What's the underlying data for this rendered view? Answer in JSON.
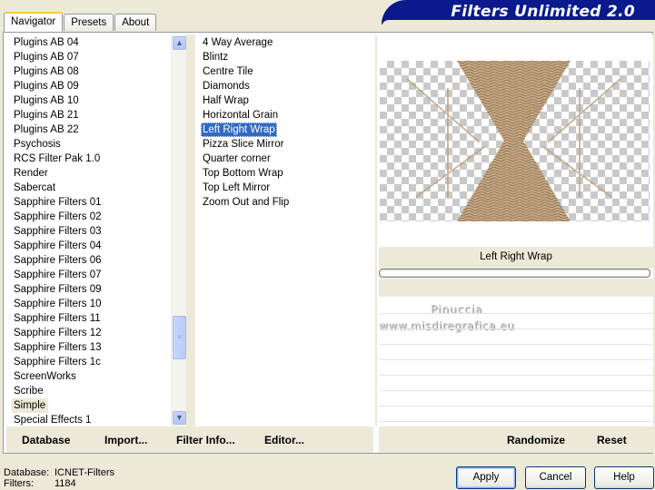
{
  "app": {
    "title": "Filters Unlimited 2.0"
  },
  "tabs": [
    {
      "label": "Navigator",
      "active": true
    },
    {
      "label": "Presets",
      "active": false
    },
    {
      "label": "About",
      "active": false
    }
  ],
  "categories": {
    "items": [
      "Plugins AB 04",
      "Plugins AB 07",
      "Plugins AB 08",
      "Plugins AB 09",
      "Plugins AB 10",
      "Plugins AB 21",
      "Plugins AB 22",
      "Psychosis",
      "RCS Filter Pak 1.0",
      "Render",
      "Sabercat",
      "Sapphire Filters 01",
      "Sapphire Filters 02",
      "Sapphire Filters 03",
      "Sapphire Filters 04",
      "Sapphire Filters 06",
      "Sapphire Filters 07",
      "Sapphire Filters 09",
      "Sapphire Filters 10",
      "Sapphire Filters 11",
      "Sapphire Filters 12",
      "Sapphire Filters 13",
      "Sapphire Filters 1c",
      "ScreenWorks",
      "Scribe",
      "Simple",
      "Special Effects 1"
    ],
    "selected": "Simple"
  },
  "filters": {
    "items": [
      "4 Way Average",
      "Blintz",
      "Centre Tile",
      "Diamonds",
      "Half Wrap",
      "Horizontal Grain",
      "Left Right Wrap",
      "Pizza Slice Mirror",
      "Quarter corner",
      "Top Bottom Wrap",
      "Top Left Mirror",
      "Zoom Out and Flip"
    ],
    "selected": "Left Right Wrap"
  },
  "preview": {
    "filter_name": "Left Right Wrap",
    "progress": 0,
    "watermark_line1": "Pinuccia",
    "watermark_line2": "www.misdiregrafica.eu",
    "colors": {
      "pattern": "#b99c79",
      "pattern_dark": "#8f7252",
      "checker": "#c9c9c9"
    }
  },
  "toolbar": {
    "database": "Database",
    "import": "Import...",
    "filter_info": "Filter Info...",
    "editor": "Editor...",
    "randomize": "Randomize",
    "reset": "Reset"
  },
  "status": {
    "database_label": "Database:",
    "database_value": "ICNET-Filters",
    "filters_label": "Filters:",
    "filters_value": "1184"
  },
  "buttons": {
    "apply": "Apply",
    "cancel": "Cancel",
    "help": "Help"
  },
  "theme": {
    "banner": "#0a1a8c",
    "selection": "#316ac5",
    "face": "#ece9d8"
  }
}
